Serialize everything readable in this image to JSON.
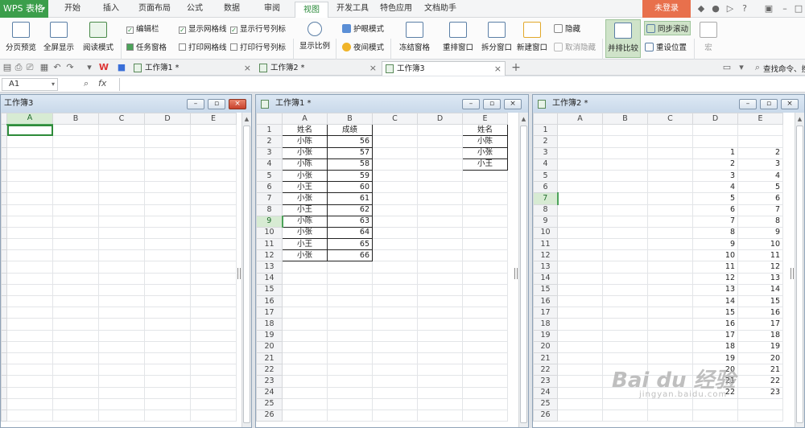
{
  "app": {
    "name": "WPS 表格"
  },
  "menu": {
    "tabs": [
      "开始",
      "插入",
      "页面布局",
      "公式",
      "数据",
      "审阅",
      "视图",
      "开发工具",
      "特色应用",
      "文档助手"
    ],
    "active_tab": "视图",
    "login_label": "未登录"
  },
  "ribbon": {
    "buttons": [
      "分页预览",
      "全屏显示",
      "阅读模式",
      "显示比例",
      "冻结窗格",
      "重排窗口",
      "拆分窗口",
      "新建窗口",
      "并排比较",
      "宏"
    ],
    "checkboxes": [
      {
        "label": "编辑栏",
        "checked": true
      },
      {
        "label": "任务窗格",
        "checked": false
      },
      {
        "label": "显示网格线",
        "checked": true
      },
      {
        "label": "打印网格线",
        "checked": false
      },
      {
        "label": "显示行号列标",
        "checked": true
      },
      {
        "label": "打印行号列标",
        "checked": false
      }
    ],
    "small": [
      "护眼模式",
      "夜间模式",
      "隐藏",
      "取消隐藏",
      "同步滚动",
      "重设位置"
    ]
  },
  "doc_tabs": [
    {
      "label": "工作簿1 *"
    },
    {
      "label": "工作簿2 *"
    },
    {
      "label": "工作簿3"
    }
  ],
  "active_doc_tab": "工作簿3",
  "search_placeholder": "查找命令、搜",
  "formula": {
    "cell_ref": "A1",
    "fx": "fx",
    "value": ""
  },
  "windows": {
    "w3": {
      "title": "工作簿3",
      "columns": [
        "A",
        "B",
        "C",
        "D",
        "E"
      ],
      "active_cell": "A1",
      "row_count": 0
    },
    "w1": {
      "title": "工作簿1 *",
      "columns": [
        "A",
        "B",
        "C",
        "D",
        "E"
      ],
      "selected_row": 9,
      "rows": [
        [
          "姓名",
          "成绩",
          "",
          "",
          "姓名"
        ],
        [
          "小陈",
          "56",
          "",
          "",
          "小陈"
        ],
        [
          "小张",
          "57",
          "",
          "",
          "小张"
        ],
        [
          "小陈",
          "58",
          "",
          "",
          "小王"
        ],
        [
          "小张",
          "59",
          "",
          "",
          ""
        ],
        [
          "小王",
          "60",
          "",
          "",
          ""
        ],
        [
          "小张",
          "61",
          "",
          "",
          ""
        ],
        [
          "小王",
          "62",
          "",
          "",
          ""
        ],
        [
          "小陈",
          "63",
          "",
          "",
          ""
        ],
        [
          "小张",
          "64",
          "",
          "",
          ""
        ],
        [
          "小王",
          "65",
          "",
          "",
          ""
        ],
        [
          "小张",
          "66",
          "",
          "",
          ""
        ]
      ],
      "row_count": 27
    },
    "w2": {
      "title": "工作簿2 *",
      "columns": [
        "A",
        "B",
        "C",
        "D",
        "E"
      ],
      "selected_row": 7,
      "rows": [
        [
          "",
          "",
          "",
          "",
          ""
        ],
        [
          "",
          "",
          "",
          "",
          ""
        ],
        [
          "",
          "",
          "",
          "1",
          "2"
        ],
        [
          "",
          "",
          "",
          "2",
          "3"
        ],
        [
          "",
          "",
          "",
          "3",
          "4"
        ],
        [
          "",
          "",
          "",
          "4",
          "5"
        ],
        [
          "",
          "",
          "",
          "5",
          "6"
        ],
        [
          "",
          "",
          "",
          "6",
          "7"
        ],
        [
          "",
          "",
          "",
          "7",
          "8"
        ],
        [
          "",
          "",
          "",
          "8",
          "9"
        ],
        [
          "",
          "",
          "",
          "9",
          "10"
        ],
        [
          "",
          "",
          "",
          "10",
          "11"
        ],
        [
          "",
          "",
          "",
          "11",
          "12"
        ],
        [
          "",
          "",
          "",
          "12",
          "13"
        ],
        [
          "",
          "",
          "",
          "13",
          "14"
        ],
        [
          "",
          "",
          "",
          "14",
          "15"
        ],
        [
          "",
          "",
          "",
          "15",
          "16"
        ],
        [
          "",
          "",
          "",
          "16",
          "17"
        ],
        [
          "",
          "",
          "",
          "17",
          "18"
        ],
        [
          "",
          "",
          "",
          "18",
          "19"
        ],
        [
          "",
          "",
          "",
          "19",
          "20"
        ],
        [
          "",
          "",
          "",
          "20",
          "21"
        ],
        [
          "",
          "",
          "",
          "21",
          "22"
        ],
        [
          "",
          "",
          "",
          "22",
          "23"
        ]
      ],
      "row_count": 27
    }
  },
  "watermark": {
    "main": "Bai du 经验",
    "sub": "jingyan.baidu.com"
  }
}
